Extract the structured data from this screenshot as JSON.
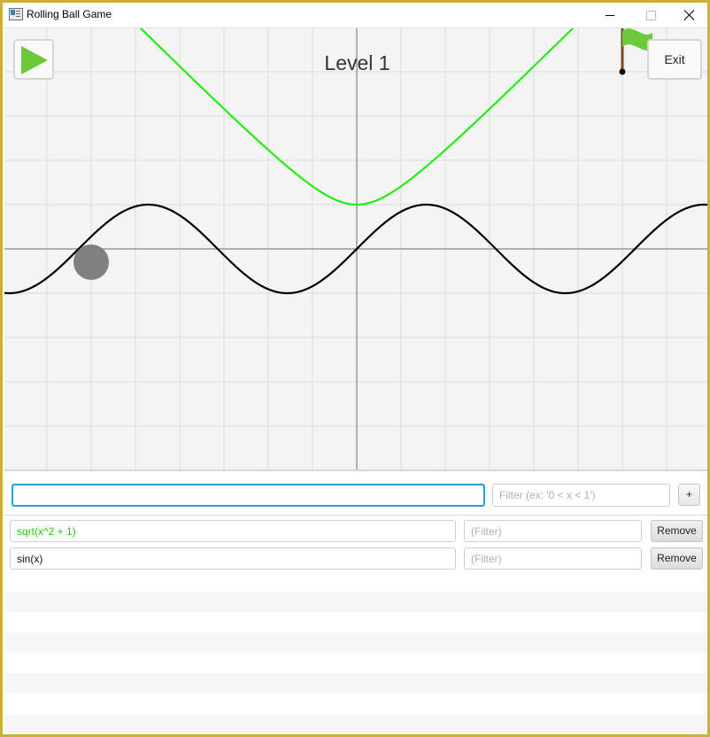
{
  "window": {
    "title": "Rolling Ball Game",
    "icon": "app-window-icon",
    "border_color": "#c9b037"
  },
  "game": {
    "level_title": "Level 1",
    "exit_label": "Exit",
    "play_icon": "play-icon",
    "goal_icon": "green-flag-icon",
    "ball_color": "#808080",
    "grid": true
  },
  "chart_data": {
    "type": "line",
    "xlim": [
      -8,
      8
    ],
    "ylim": [
      -5,
      5
    ],
    "grid": true,
    "series": [
      {
        "name": "sqrt(x^2 + 1)",
        "color": "#22ee11",
        "fn": "sqrt"
      },
      {
        "name": "sin(x)",
        "color": "#000000",
        "fn": "sin"
      }
    ],
    "ball": {
      "x": -6,
      "y": -0.3
    },
    "flag": {
      "x": 6,
      "y": 4
    }
  },
  "input": {
    "function_value": "",
    "filter_placeholder": "Filter (ex: '0 < x < 1')",
    "add_label": "+"
  },
  "functions": [
    {
      "expression": "sqrt(x^2 + 1)",
      "color": "#22cc00",
      "filter_placeholder": "(Filter)",
      "remove_label": "Remove"
    },
    {
      "expression": "sin(x)",
      "color": "#111111",
      "filter_placeholder": "(Filter)",
      "remove_label": "Remove"
    }
  ]
}
